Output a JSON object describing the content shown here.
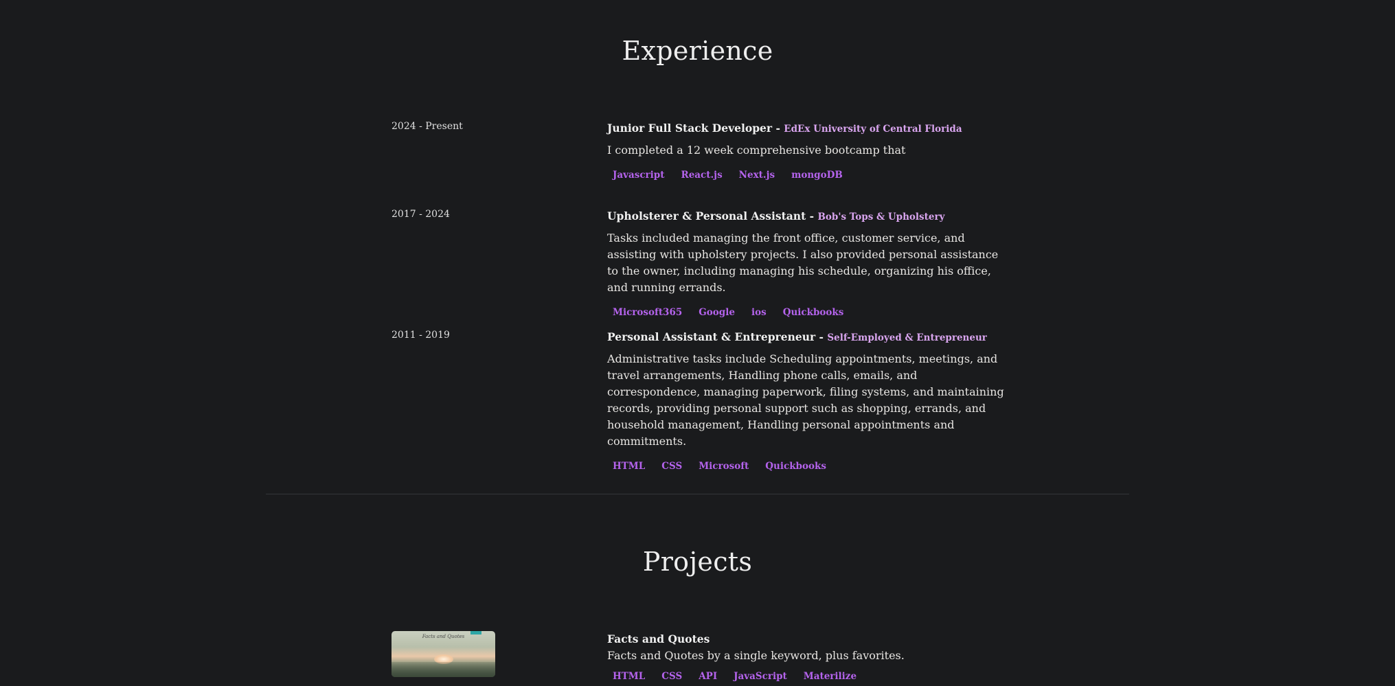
{
  "experience": {
    "title": "Experience",
    "entries": [
      {
        "date": "2024 - Present",
        "role": "Junior Full Stack Developer - ",
        "company": "EdEx University of Central Florida",
        "description": "I completed a 12 week comprehensive bootcamp that",
        "tags": [
          "Javascript",
          "React.js",
          "Next.js",
          "mongoDB"
        ]
      },
      {
        "date": "2017 - 2024",
        "role": "Upholsterer & Personal Assistant - ",
        "company": "Bob's Tops & Upholstery",
        "description": "Tasks included managing the front office, customer service, and assisting with upholstery projects. I also provided personal assistance to the owner, including managing his schedule, organizing his office, and running errands.",
        "tags": [
          "Microsoft365",
          "Google",
          "ios",
          "Quickbooks"
        ]
      },
      {
        "date": "2011 - 2019",
        "role": "Personal Assistant & Entrepreneur - ",
        "company": "Self-Employed & Entrepreneur",
        "description": "Administrative tasks include Scheduling appointments, meetings, and travel arrangements, Handling phone calls, emails, and correspondence, managing paperwork, filing systems, and maintaining records, providing personal support such as shopping, errands, and household management, Handling personal appointments and commitments.",
        "tags": [
          "HTML",
          "CSS",
          "Microsoft",
          "Quickbooks"
        ]
      }
    ]
  },
  "projects": {
    "title": "Projects",
    "items": [
      {
        "name": "Facts and Quotes",
        "description": "Facts and Quotes by a single keyword, plus favorites.",
        "thumbnail_caption": "Facts and Quotes",
        "tags": [
          "HTML",
          "CSS",
          "API",
          "JavaScript",
          "Materilize"
        ]
      }
    ]
  },
  "colors": {
    "background": "#1a1b1d",
    "tag": "#b463ec",
    "company": "#d9a5ef",
    "divider": "#34363a"
  }
}
